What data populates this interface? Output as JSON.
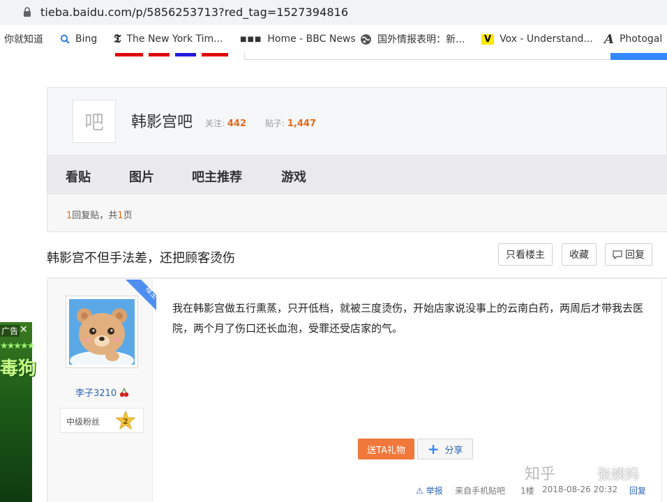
{
  "browser": {
    "url": "tieba.baidu.com/p/5856253713?red_tag=1527394816",
    "bookmarks": [
      {
        "label": "你就知道",
        "icon": "none"
      },
      {
        "label": "Bing",
        "icon": "search-icon"
      },
      {
        "label": "The New York Tim...",
        "icon": "nyt-icon"
      },
      {
        "label": "Home - BBC News",
        "icon": "bbc-icon"
      },
      {
        "label": "国外情报表明：新...",
        "icon": "globe-icon"
      },
      {
        "label": "Vox - Understand...",
        "icon": "vox-icon"
      },
      {
        "label": "Photogal",
        "icon": "photogal-icon"
      }
    ]
  },
  "forum": {
    "icon_char": "吧",
    "name": "韩影宫吧",
    "follow_label": "关注:",
    "follow_count": "442",
    "posts_label": "贴子:",
    "posts_count": "1,447"
  },
  "tabs": [
    "看贴",
    "图片",
    "吧主推荐",
    "游戏"
  ],
  "pager": {
    "count": "1",
    "mid": "回复贴，共",
    "pages": "1",
    "end": "页"
  },
  "thread": {
    "title": "韩影宫不但手法差，还把顾客烫伤",
    "buttons": {
      "only_op": "只看楼主",
      "favorite": "收藏",
      "reply": "回复"
    }
  },
  "post": {
    "ribbon": "楼主",
    "username": "李子3210",
    "level_label": "中级粉丝",
    "level_num": "2",
    "content": "我在韩影宫做五行熏蒸，只开低档，就被三度烫伤，开始店家说没事上的云南白药，两周后才带我去医院，两个月了伤口还长血泡，受罪还受店家的气。",
    "gift_label": "送TA礼物",
    "share_label": "分享",
    "report_label": "举报",
    "source": "来自手机贴吧",
    "floor": "1楼",
    "datetime": "2018-08-26 20:32",
    "reply_label": "回复"
  },
  "ad": {
    "tag": "广告",
    "close": "✕",
    "stars": "★★★★★",
    "text": "毒狗"
  },
  "watermark": {
    "site": "知乎",
    "author": "张姨妈"
  },
  "colors": {
    "accent_orange": "#e1691b",
    "link_blue": "#2d64b3",
    "gift_orange": "#f0783a"
  }
}
